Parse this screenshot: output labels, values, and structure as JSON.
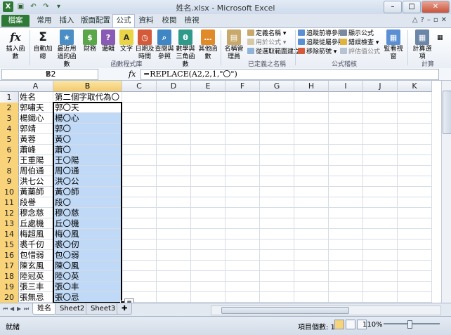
{
  "window": {
    "title": "姓名.xlsx - Microsoft Excel"
  },
  "tabs": [
    "檔案",
    "常用",
    "插入",
    "版面配置",
    "公式",
    "資料",
    "校閱",
    "檢視"
  ],
  "ribbon": {
    "insert_function": "插入函數",
    "autosum": "自動加總",
    "recent": "最近用過的函數",
    "financial": "財務",
    "logical": "邏輯",
    "text": "文字",
    "datetime": "日期及時間",
    "lookup": "查閱與參照",
    "math": "數學與三角函數",
    "more": "其他函數",
    "group_library": "函數程式庫",
    "name_manager": "名稱管理員",
    "define_name": "定義名稱",
    "use_in_formula": "用於公式",
    "create_from_selection": "從選取範圍建立",
    "group_names": "已定義之名稱",
    "trace_precedents": "追蹤前導參照",
    "trace_dependents": "追蹤從屬參照",
    "remove_arrows": "移除箭號",
    "show_formulas": "顯示公式",
    "error_checking": "錯誤檢查",
    "evaluate_formula": "評估值公式",
    "group_auditing": "公式稽核",
    "watch_window": "監看視窗",
    "calc_options": "計算選項",
    "group_calc": "計算"
  },
  "formula_bar": {
    "name_box": "B2",
    "fx": "fx",
    "formula": "=REPLACE(A2,2,1,\"〇\")"
  },
  "columns": [
    "A",
    "B",
    "C",
    "D",
    "E",
    "F",
    "G",
    "H",
    "I",
    "J",
    "K"
  ],
  "rows": [
    [
      "姓名",
      "第二個字取代為〇"
    ],
    [
      "郭嘯天",
      "郭〇天"
    ],
    [
      "楊鐵心",
      "楊〇心"
    ],
    [
      "郭靖",
      "郭〇"
    ],
    [
      "黃蓉",
      "黃〇"
    ],
    [
      "蕭峰",
      "蕭〇"
    ],
    [
      "王重陽",
      "王〇陽"
    ],
    [
      "周伯通",
      "周〇通"
    ],
    [
      "洪七公",
      "洪〇公"
    ],
    [
      "黃藥師",
      "黃〇師"
    ],
    [
      "段譽",
      "段〇"
    ],
    [
      "穆念慈",
      "穆〇慈"
    ],
    [
      "丘處機",
      "丘〇機"
    ],
    [
      "梅超風",
      "梅〇風"
    ],
    [
      "裘千仞",
      "裘〇仞"
    ],
    [
      "包惜弱",
      "包〇弱"
    ],
    [
      "陳玄風",
      "陳〇風"
    ],
    [
      "陸冠英",
      "陸〇英"
    ],
    [
      "張三丰",
      "張〇丰"
    ],
    [
      "張無忌",
      "張〇忌"
    ]
  ],
  "sheets": [
    "姓名",
    "Sheet2",
    "Sheet3"
  ],
  "status": {
    "ready": "就緒",
    "count": "項目個數: 19",
    "zoom": "110%"
  }
}
